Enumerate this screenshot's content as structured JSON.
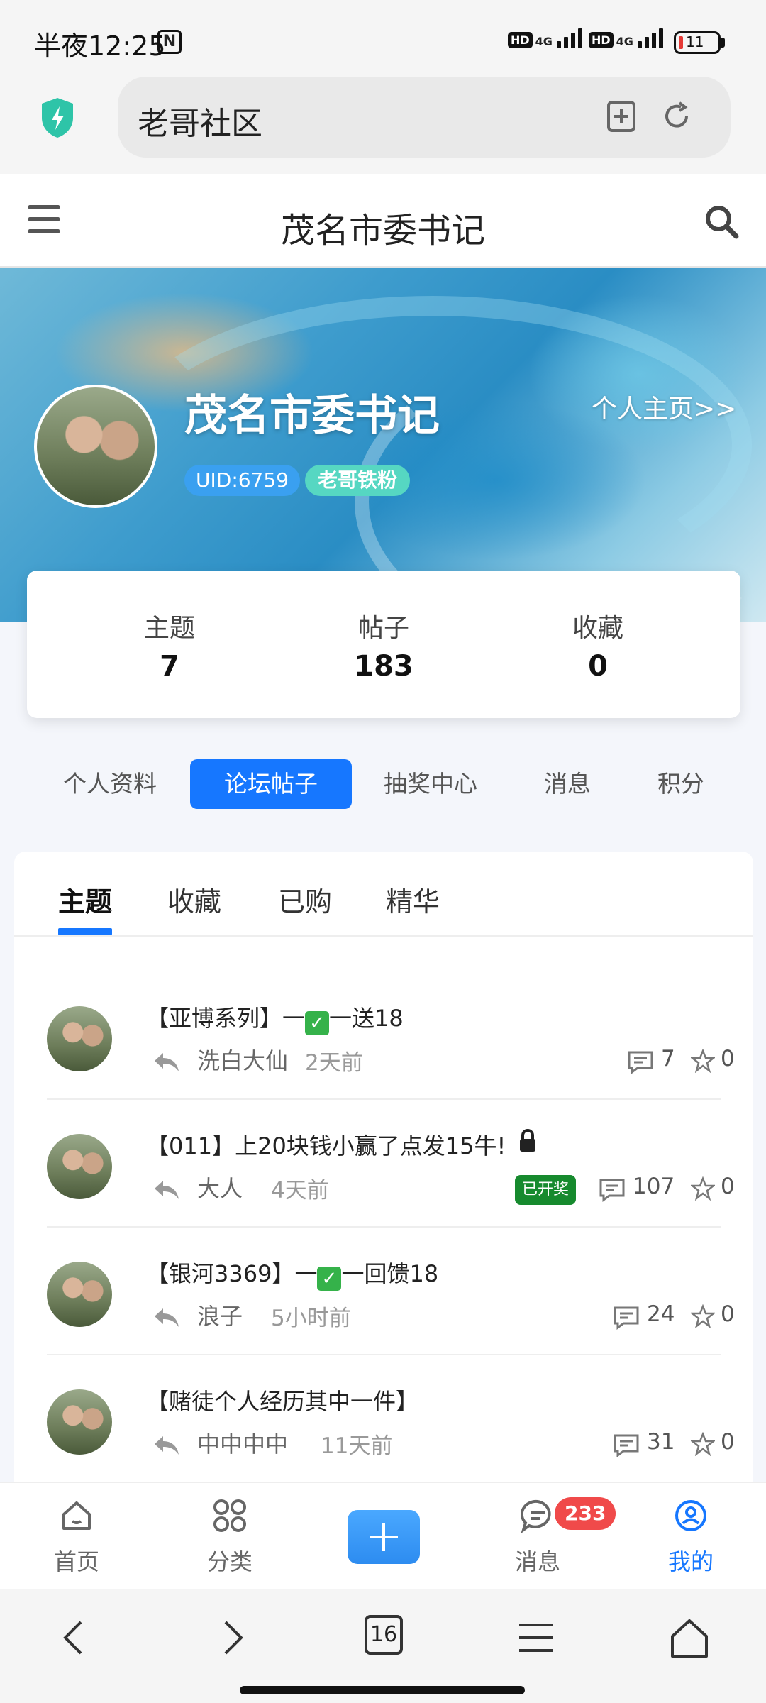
{
  "status_bar": {
    "time": "半夜12:25",
    "nfc": "N",
    "hd": "HD",
    "network": "4G",
    "battery": "11"
  },
  "browser": {
    "url": "老哥社区"
  },
  "header": {
    "title": "茂名市委书记"
  },
  "profile": {
    "name": "茂名市委书记",
    "uid": "UID:6759",
    "badge": "老哥铁粉",
    "homepage_link": "个人主页>>"
  },
  "stats": [
    {
      "label": "主题",
      "value": "7"
    },
    {
      "label": "帖子",
      "value": "183"
    },
    {
      "label": "收藏",
      "value": "0"
    }
  ],
  "nav_tabs": [
    {
      "label": "个人资料",
      "active": false
    },
    {
      "label": "论坛帖子",
      "active": true
    },
    {
      "label": "抽奖中心",
      "active": false
    },
    {
      "label": "消息",
      "active": false
    },
    {
      "label": "积分",
      "active": false
    }
  ],
  "sub_tabs": [
    {
      "label": "主题",
      "active": true
    },
    {
      "label": "收藏",
      "active": false
    },
    {
      "label": "已购",
      "active": false
    },
    {
      "label": "精华",
      "active": false
    }
  ],
  "posts": [
    {
      "title_pre": "【亚博系列】一",
      "title_post": "一送18",
      "check": "✓",
      "author": "洗白大仙",
      "time": "2天前",
      "comments": "7",
      "stars": "0"
    },
    {
      "title": "【011】上20块钱小赢了点发15牛!",
      "locked": true,
      "author": "大人",
      "time": "4天前",
      "prize_badge": "已开奖",
      "comments": "107",
      "stars": "0"
    },
    {
      "title_pre": "【银河3369】一",
      "title_post": "一回馈18",
      "check": "✓",
      "author": "浪子",
      "time": "5小时前",
      "comments": "24",
      "stars": "0"
    },
    {
      "title": "【赌徒个人经历其中一件】",
      "author": "中中中中",
      "time": "11天前",
      "comments": "31",
      "stars": "0"
    }
  ],
  "tabbar": {
    "home": "首页",
    "category": "分类",
    "messages": "消息",
    "messages_badge": "233",
    "mine": "我的"
  },
  "browser_nav": {
    "tab_count": "16"
  },
  "colors": {
    "accent": "#1677ff",
    "badge_red": "#f04a4a",
    "prize_green": "#168a2e"
  }
}
